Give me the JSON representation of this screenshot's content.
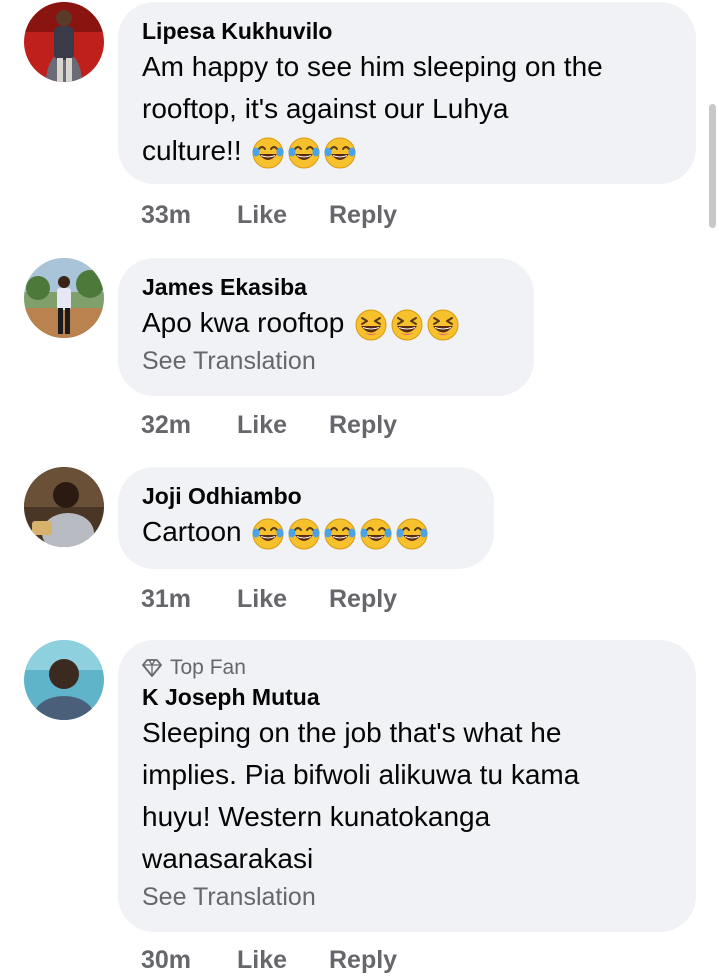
{
  "comments": [
    {
      "author": "Lipesa Kukhuvilo",
      "text_lines": [
        "Am happy to see him sleeping on the",
        "rooftop, it's against our Luhya",
        "culture!!"
      ],
      "emoji_count": 3,
      "emoji_icon": "face-with-tears-of-joy-icon",
      "time": "33m",
      "like": "Like",
      "reply": "Reply"
    },
    {
      "author": "James Ekasiba",
      "text_lines": [
        "Apo kwa rooftop"
      ],
      "emoji_count": 3,
      "emoji_icon": "grinning-squinting-face-icon",
      "see_translation": "See Translation",
      "time": "32m",
      "like": "Like",
      "reply": "Reply"
    },
    {
      "author": "Joji Odhiambo",
      "text_lines": [
        "Cartoon"
      ],
      "emoji_count": 5,
      "emoji_icon": "face-with-tears-of-joy-icon",
      "time": "31m",
      "like": "Like",
      "reply": "Reply"
    },
    {
      "badge": "Top Fan",
      "author": "K Joseph Mutua",
      "text_lines": [
        "Sleeping on the job that's what he",
        "implies. Pia bifwoli alikuwa tu kama",
        "huyu! Western kunatokanga",
        "wanasarakasi"
      ],
      "see_translation": "See Translation",
      "time": "30m",
      "like": "Like",
      "reply": "Reply"
    }
  ],
  "colors": {
    "bubble": "#f0f2f5",
    "secondary_text": "#65676b",
    "primary_text": "#050505"
  }
}
